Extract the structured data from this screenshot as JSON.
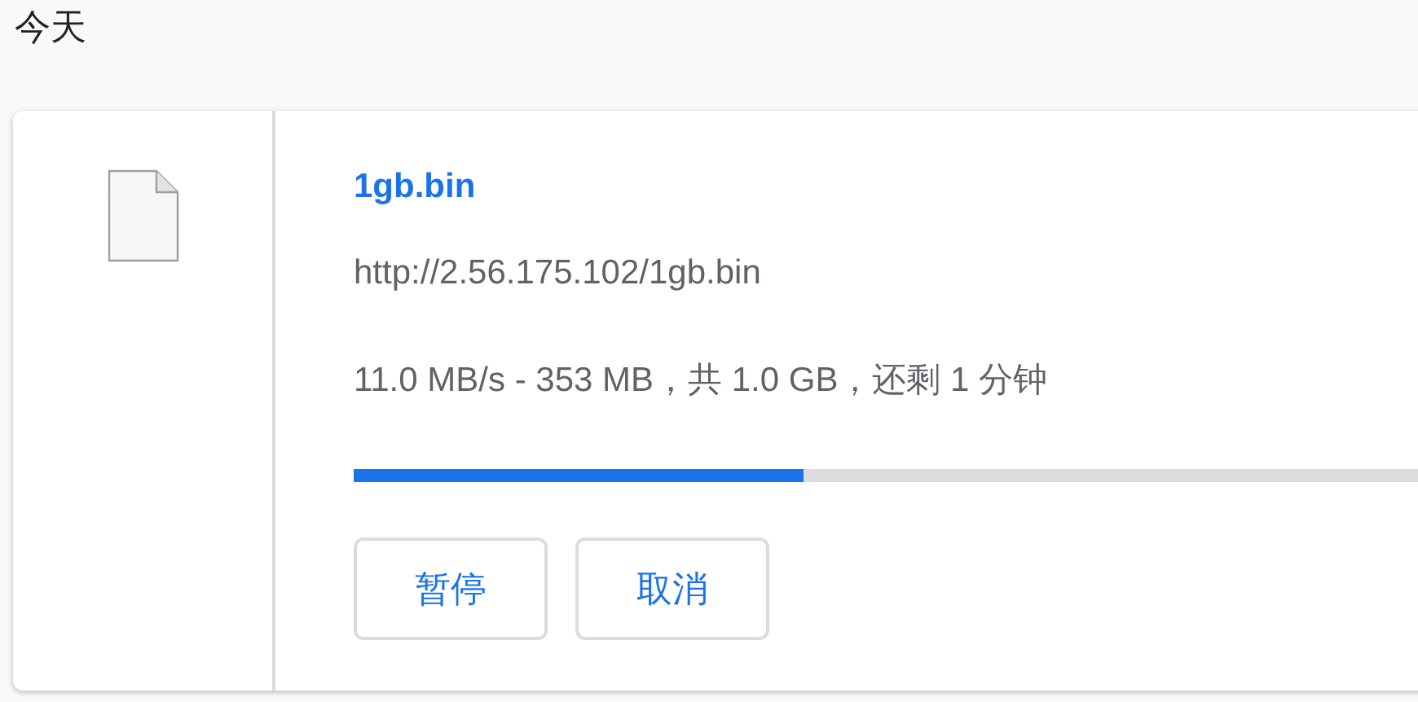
{
  "section_title": "今天",
  "download": {
    "file_name": "1gb.bin",
    "url": "http://2.56.175.102/1gb.bin",
    "status": "11.0 MB/s - 353 MB，共 1.0 GB，还剩 1 分钟",
    "level": 0.345,
    "buttons": [
      {
        "label": "暂停"
      },
      {
        "label": "取消"
      }
    ]
  }
}
